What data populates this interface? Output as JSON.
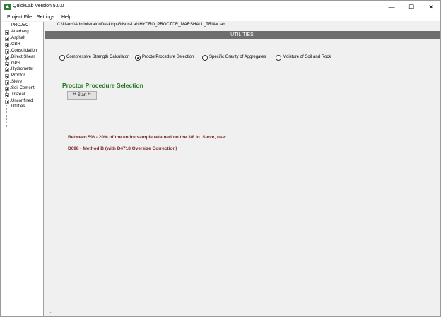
{
  "window": {
    "title": "QuickLab  Version 5.0.0",
    "controls": {
      "minimize": "—",
      "maximize": "☐",
      "close": "✕"
    },
    "app_icon": "quicklab-logo-icon"
  },
  "menu": [
    "Project File",
    "Settings",
    "Help"
  ],
  "tree": {
    "root": "PROJECT",
    "items": [
      "Atterberg",
      "Asphalt",
      "CBR",
      "Consolidation",
      "Direct Shear",
      "GPS",
      "Hydrometer",
      "Proctor",
      "Sieve",
      "Soil Cement",
      "Triaxial",
      "Unconfined"
    ],
    "leaf": "Utilities"
  },
  "file_path": "C:\\Users\\Administrator\\Desktop\\Gilson-Lab\\HYDRO_PROCTOR_MARSHALL_TRIAX.lab",
  "header": "UTILITIES",
  "options": [
    {
      "label": "Compressive Strength Calculator",
      "selected": false
    },
    {
      "label": "ProctorProcedure Selection",
      "selected": true
    },
    {
      "label": "Specific Gravity of Aggregates",
      "selected": false
    },
    {
      "label": "Moisture of Soil and Rock",
      "selected": false
    }
  ],
  "section_title": "Proctor Procedure Selection",
  "start_button": "** Start **",
  "result": {
    "line1": "Between 5% - 20% of the entire sample retained on the 3/8 in. Sieve, use:",
    "line2": "D698 - Method B (with D4718 Oversize Correction)"
  },
  "status": "...",
  "colors": {
    "header_bg": "#6e6e6e",
    "section_title": "#1f7a1f",
    "result_text": "#7a2a2a"
  }
}
